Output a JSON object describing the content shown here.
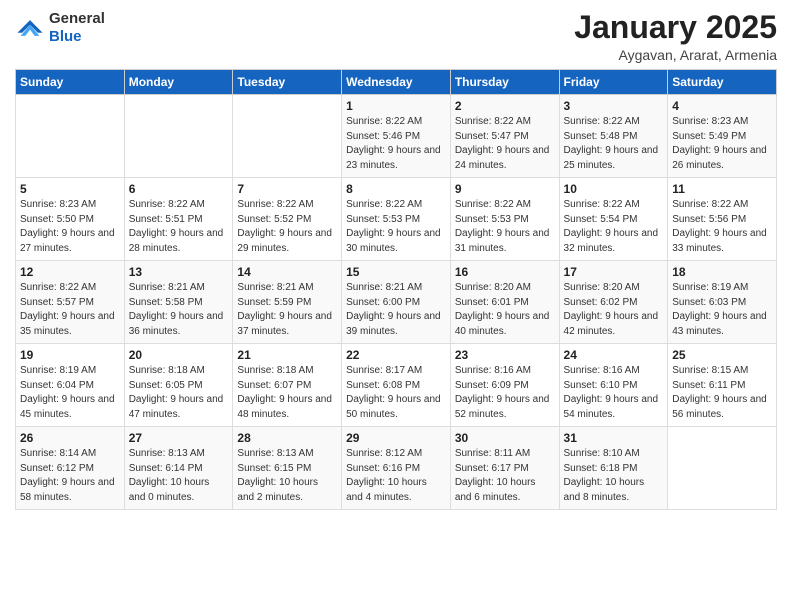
{
  "header": {
    "logo_general": "General",
    "logo_blue": "Blue",
    "title": "January 2025",
    "subtitle": "Aygavan, Ararat, Armenia"
  },
  "weekdays": [
    "Sunday",
    "Monday",
    "Tuesday",
    "Wednesday",
    "Thursday",
    "Friday",
    "Saturday"
  ],
  "weeks": [
    [
      {
        "day": "",
        "sunrise": "",
        "sunset": "",
        "daylight": ""
      },
      {
        "day": "",
        "sunrise": "",
        "sunset": "",
        "daylight": ""
      },
      {
        "day": "",
        "sunrise": "",
        "sunset": "",
        "daylight": ""
      },
      {
        "day": "1",
        "sunrise": "Sunrise: 8:22 AM",
        "sunset": "Sunset: 5:46 PM",
        "daylight": "Daylight: 9 hours and 23 minutes."
      },
      {
        "day": "2",
        "sunrise": "Sunrise: 8:22 AM",
        "sunset": "Sunset: 5:47 PM",
        "daylight": "Daylight: 9 hours and 24 minutes."
      },
      {
        "day": "3",
        "sunrise": "Sunrise: 8:22 AM",
        "sunset": "Sunset: 5:48 PM",
        "daylight": "Daylight: 9 hours and 25 minutes."
      },
      {
        "day": "4",
        "sunrise": "Sunrise: 8:23 AM",
        "sunset": "Sunset: 5:49 PM",
        "daylight": "Daylight: 9 hours and 26 minutes."
      }
    ],
    [
      {
        "day": "5",
        "sunrise": "Sunrise: 8:23 AM",
        "sunset": "Sunset: 5:50 PM",
        "daylight": "Daylight: 9 hours and 27 minutes."
      },
      {
        "day": "6",
        "sunrise": "Sunrise: 8:22 AM",
        "sunset": "Sunset: 5:51 PM",
        "daylight": "Daylight: 9 hours and 28 minutes."
      },
      {
        "day": "7",
        "sunrise": "Sunrise: 8:22 AM",
        "sunset": "Sunset: 5:52 PM",
        "daylight": "Daylight: 9 hours and 29 minutes."
      },
      {
        "day": "8",
        "sunrise": "Sunrise: 8:22 AM",
        "sunset": "Sunset: 5:53 PM",
        "daylight": "Daylight: 9 hours and 30 minutes."
      },
      {
        "day": "9",
        "sunrise": "Sunrise: 8:22 AM",
        "sunset": "Sunset: 5:53 PM",
        "daylight": "Daylight: 9 hours and 31 minutes."
      },
      {
        "day": "10",
        "sunrise": "Sunrise: 8:22 AM",
        "sunset": "Sunset: 5:54 PM",
        "daylight": "Daylight: 9 hours and 32 minutes."
      },
      {
        "day": "11",
        "sunrise": "Sunrise: 8:22 AM",
        "sunset": "Sunset: 5:56 PM",
        "daylight": "Daylight: 9 hours and 33 minutes."
      }
    ],
    [
      {
        "day": "12",
        "sunrise": "Sunrise: 8:22 AM",
        "sunset": "Sunset: 5:57 PM",
        "daylight": "Daylight: 9 hours and 35 minutes."
      },
      {
        "day": "13",
        "sunrise": "Sunrise: 8:21 AM",
        "sunset": "Sunset: 5:58 PM",
        "daylight": "Daylight: 9 hours and 36 minutes."
      },
      {
        "day": "14",
        "sunrise": "Sunrise: 8:21 AM",
        "sunset": "Sunset: 5:59 PM",
        "daylight": "Daylight: 9 hours and 37 minutes."
      },
      {
        "day": "15",
        "sunrise": "Sunrise: 8:21 AM",
        "sunset": "Sunset: 6:00 PM",
        "daylight": "Daylight: 9 hours and 39 minutes."
      },
      {
        "day": "16",
        "sunrise": "Sunrise: 8:20 AM",
        "sunset": "Sunset: 6:01 PM",
        "daylight": "Daylight: 9 hours and 40 minutes."
      },
      {
        "day": "17",
        "sunrise": "Sunrise: 8:20 AM",
        "sunset": "Sunset: 6:02 PM",
        "daylight": "Daylight: 9 hours and 42 minutes."
      },
      {
        "day": "18",
        "sunrise": "Sunrise: 8:19 AM",
        "sunset": "Sunset: 6:03 PM",
        "daylight": "Daylight: 9 hours and 43 minutes."
      }
    ],
    [
      {
        "day": "19",
        "sunrise": "Sunrise: 8:19 AM",
        "sunset": "Sunset: 6:04 PM",
        "daylight": "Daylight: 9 hours and 45 minutes."
      },
      {
        "day": "20",
        "sunrise": "Sunrise: 8:18 AM",
        "sunset": "Sunset: 6:05 PM",
        "daylight": "Daylight: 9 hours and 47 minutes."
      },
      {
        "day": "21",
        "sunrise": "Sunrise: 8:18 AM",
        "sunset": "Sunset: 6:07 PM",
        "daylight": "Daylight: 9 hours and 48 minutes."
      },
      {
        "day": "22",
        "sunrise": "Sunrise: 8:17 AM",
        "sunset": "Sunset: 6:08 PM",
        "daylight": "Daylight: 9 hours and 50 minutes."
      },
      {
        "day": "23",
        "sunrise": "Sunrise: 8:16 AM",
        "sunset": "Sunset: 6:09 PM",
        "daylight": "Daylight: 9 hours and 52 minutes."
      },
      {
        "day": "24",
        "sunrise": "Sunrise: 8:16 AM",
        "sunset": "Sunset: 6:10 PM",
        "daylight": "Daylight: 9 hours and 54 minutes."
      },
      {
        "day": "25",
        "sunrise": "Sunrise: 8:15 AM",
        "sunset": "Sunset: 6:11 PM",
        "daylight": "Daylight: 9 hours and 56 minutes."
      }
    ],
    [
      {
        "day": "26",
        "sunrise": "Sunrise: 8:14 AM",
        "sunset": "Sunset: 6:12 PM",
        "daylight": "Daylight: 9 hours and 58 minutes."
      },
      {
        "day": "27",
        "sunrise": "Sunrise: 8:13 AM",
        "sunset": "Sunset: 6:14 PM",
        "daylight": "Daylight: 10 hours and 0 minutes."
      },
      {
        "day": "28",
        "sunrise": "Sunrise: 8:13 AM",
        "sunset": "Sunset: 6:15 PM",
        "daylight": "Daylight: 10 hours and 2 minutes."
      },
      {
        "day": "29",
        "sunrise": "Sunrise: 8:12 AM",
        "sunset": "Sunset: 6:16 PM",
        "daylight": "Daylight: 10 hours and 4 minutes."
      },
      {
        "day": "30",
        "sunrise": "Sunrise: 8:11 AM",
        "sunset": "Sunset: 6:17 PM",
        "daylight": "Daylight: 10 hours and 6 minutes."
      },
      {
        "day": "31",
        "sunrise": "Sunrise: 8:10 AM",
        "sunset": "Sunset: 6:18 PM",
        "daylight": "Daylight: 10 hours and 8 minutes."
      },
      {
        "day": "",
        "sunrise": "",
        "sunset": "",
        "daylight": ""
      }
    ]
  ]
}
